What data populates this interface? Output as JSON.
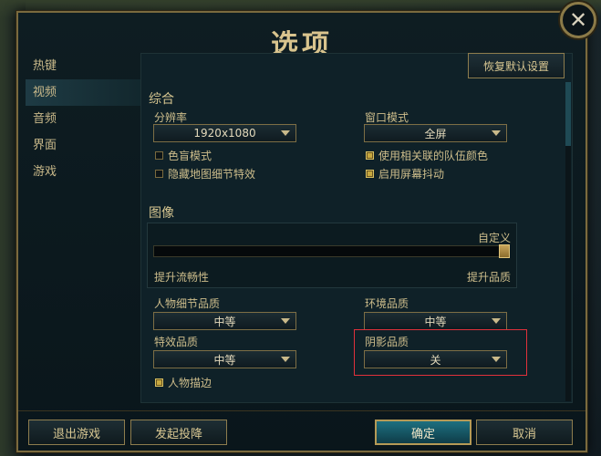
{
  "window": {
    "title": "选项",
    "close_icon": "close-icon"
  },
  "sidebar": {
    "items": [
      {
        "label": "热键",
        "active": false
      },
      {
        "label": "视频",
        "active": true
      },
      {
        "label": "音频",
        "active": false
      },
      {
        "label": "界面",
        "active": false
      },
      {
        "label": "游戏",
        "active": false
      }
    ]
  },
  "toolbar": {
    "restore_label": "恢复默认设置"
  },
  "general": {
    "title": "综合",
    "resolution_label": "分辨率",
    "resolution_value": "1920x1080",
    "window_mode_label": "窗口模式",
    "window_mode_value": "全屏",
    "colorblind_label": "色盲模式",
    "colorblind_checked": false,
    "hide_detail_label": "隐藏地图细节特效",
    "hide_detail_checked": false,
    "team_colors_label": "使用相关联的队伍颜色",
    "team_colors_checked": true,
    "screen_shake_label": "启用屏幕抖动",
    "screen_shake_checked": true
  },
  "graphics": {
    "title": "图像",
    "preset_value": "自定义",
    "left_label": "提升流畅性",
    "right_label": "提升品质",
    "slider_level": 1.0,
    "character_quality_label": "人物细节品质",
    "character_quality_value": "中等",
    "environment_quality_label": "环境品质",
    "environment_quality_value": "中等",
    "effects_quality_label": "特效品质",
    "effects_quality_value": "中等",
    "shadow_quality_label": "阴影品质",
    "shadow_quality_value": "关",
    "outline_label": "人物描边",
    "outline_checked": true
  },
  "footer": {
    "exit_label": "退出游戏",
    "surrender_label": "发起投降",
    "ok_label": "确定",
    "cancel_label": "取消"
  },
  "colors": {
    "accent_gold": "#c8aa6e",
    "highlight_red": "#e0313b",
    "primary_teal": "#1d6f80"
  }
}
